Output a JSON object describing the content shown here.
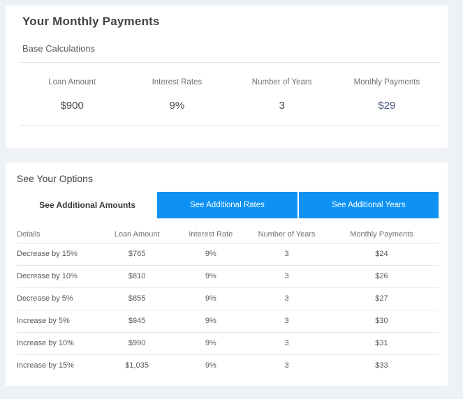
{
  "colors": {
    "background": "#eef1f5",
    "tab_blue": "#0d92f4",
    "highlight_navy": "#47597d"
  },
  "top_card": {
    "title": "Your Monthly Payments",
    "subtitle": "Base Calculations",
    "columns": [
      {
        "label": "Loan Amount",
        "value": "$900"
      },
      {
        "label": "Interest Rates",
        "value": "9%"
      },
      {
        "label": "Number of Years",
        "value": "3"
      },
      {
        "label": "Monthly Payments",
        "value": "$29"
      }
    ]
  },
  "options_card": {
    "title": "See Your Options",
    "tabs": [
      {
        "label": "See Additional Amounts",
        "active": true
      },
      {
        "label": "See Additional Rates",
        "active": false
      },
      {
        "label": "See Additional Years",
        "active": false
      }
    ],
    "table": {
      "headers": [
        "Details",
        "Loan Amount",
        "Interest Rate",
        "Number of Years",
        "Monthly Payments"
      ],
      "rows": [
        [
          "Decrease by 15%",
          "$765",
          "9%",
          "3",
          "$24"
        ],
        [
          "Decrease by 10%",
          "$810",
          "9%",
          "3",
          "$26"
        ],
        [
          "Decrease by 5%",
          "$855",
          "9%",
          "3",
          "$27"
        ],
        [
          "Increase by 5%",
          "$945",
          "9%",
          "3",
          "$30"
        ],
        [
          "Increase by 10%",
          "$990",
          "9%",
          "3",
          "$31"
        ],
        [
          "Increase by 15%",
          "$1,035",
          "9%",
          "3",
          "$33"
        ]
      ]
    }
  }
}
